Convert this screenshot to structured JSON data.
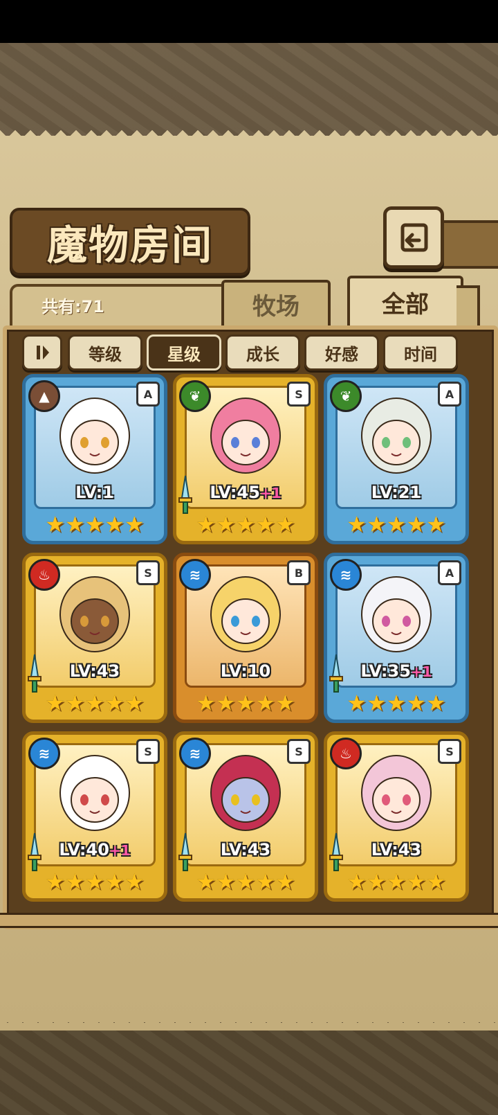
{
  "screen": {
    "title": "魔物房间",
    "count_label": "共有:71"
  },
  "tabs": [
    {
      "label": "牧场",
      "active": false
    },
    {
      "label": "全部",
      "active": true
    }
  ],
  "sort_buttons": [
    {
      "label": "等级",
      "active": false
    },
    {
      "label": "星级",
      "active": true
    },
    {
      "label": "成长",
      "active": false
    },
    {
      "label": "好感",
      "active": false
    },
    {
      "label": "时间",
      "active": false
    }
  ],
  "colors": {
    "frame_blue": "#5aa8d8",
    "frame_gold": "#e5b22a",
    "frame_bronze": "#d98e2c",
    "bonus_pink": "#ff5aa8"
  },
  "monsters": [
    {
      "lv": "LV:1",
      "bonus": "",
      "rank": "A",
      "element": "earth-icon",
      "frame": "blue",
      "stars": "★★★★★",
      "has_sword": false
    },
    {
      "lv": "LV:45",
      "bonus": "+1",
      "rank": "S",
      "element": "plant-icon",
      "frame": "gold",
      "stars": "★★★★★",
      "has_sword": true
    },
    {
      "lv": "LV:21",
      "bonus": "",
      "rank": "A",
      "element": "plant-icon",
      "frame": "blue",
      "stars": "★★★★★",
      "has_sword": false
    },
    {
      "lv": "LV:43",
      "bonus": "",
      "rank": "S",
      "element": "fire-icon",
      "frame": "gold",
      "stars": "★★★★★",
      "has_sword": true
    },
    {
      "lv": "LV:10",
      "bonus": "",
      "rank": "B",
      "element": "water-icon",
      "frame": "bronze",
      "stars": "★★★★★",
      "has_sword": false
    },
    {
      "lv": "LV:35",
      "bonus": "+1",
      "rank": "A",
      "element": "water-icon",
      "frame": "blue",
      "stars": "★★★★★",
      "has_sword": true
    },
    {
      "lv": "LV:40",
      "bonus": "+1",
      "rank": "S",
      "element": "water-icon",
      "frame": "gold",
      "stars": "★★★★★",
      "has_sword": true
    },
    {
      "lv": "LV:43",
      "bonus": "",
      "rank": "S",
      "element": "water-icon",
      "frame": "gold",
      "stars": "★★★★★",
      "has_sword": true
    },
    {
      "lv": "LV:43",
      "bonus": "",
      "rank": "S",
      "element": "fire-icon",
      "frame": "gold",
      "stars": "★★★★★",
      "has_sword": true
    }
  ]
}
